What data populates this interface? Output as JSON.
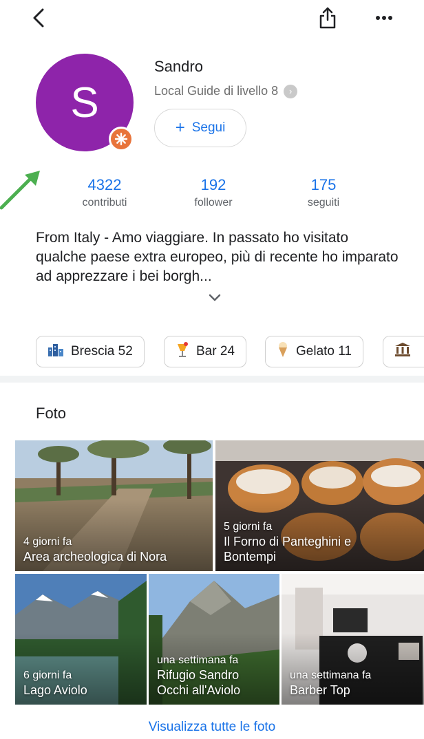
{
  "profile": {
    "avatar_letter": "S",
    "name": "Sandro",
    "level": "Local Guide di livello 8",
    "follow_label": "Segui"
  },
  "stats": [
    {
      "value": "4322",
      "label": "contributi"
    },
    {
      "value": "192",
      "label": "follower"
    },
    {
      "value": "175",
      "label": "seguiti"
    }
  ],
  "bio": "From Italy - Amo viaggiare. In passato ho visitato qualche paese extra europeo, più  di recente ho imparato ad apprezzare i bei borgh...",
  "chips": [
    {
      "icon": "city-icon",
      "label": "Brescia 52"
    },
    {
      "icon": "cocktail-icon",
      "label": "Bar 24"
    },
    {
      "icon": "ice-cream-icon",
      "label": "Gelato 11"
    },
    {
      "icon": "museum-icon",
      "label": ""
    }
  ],
  "photos": {
    "section_title": "Foto",
    "items": [
      {
        "when": "4 giorni fa",
        "title": "Area archeologica di Nora"
      },
      {
        "when": "5 giorni fa",
        "title": "Il Forno di Panteghini e Bontempi"
      },
      {
        "when": "6 giorni fa",
        "title": "Lago Aviolo"
      },
      {
        "when": "una settimana fa",
        "title": "Rifugio Sandro Occhi all'Aviolo"
      },
      {
        "when": "una settimana fa",
        "title": "Barber Top"
      }
    ],
    "see_all": "Visualizza tutte le foto"
  },
  "colors": {
    "accent": "#1a73e8",
    "avatar": "#8e24aa",
    "badge": "#e8743b",
    "annotation_arrow": "#4caf50"
  }
}
